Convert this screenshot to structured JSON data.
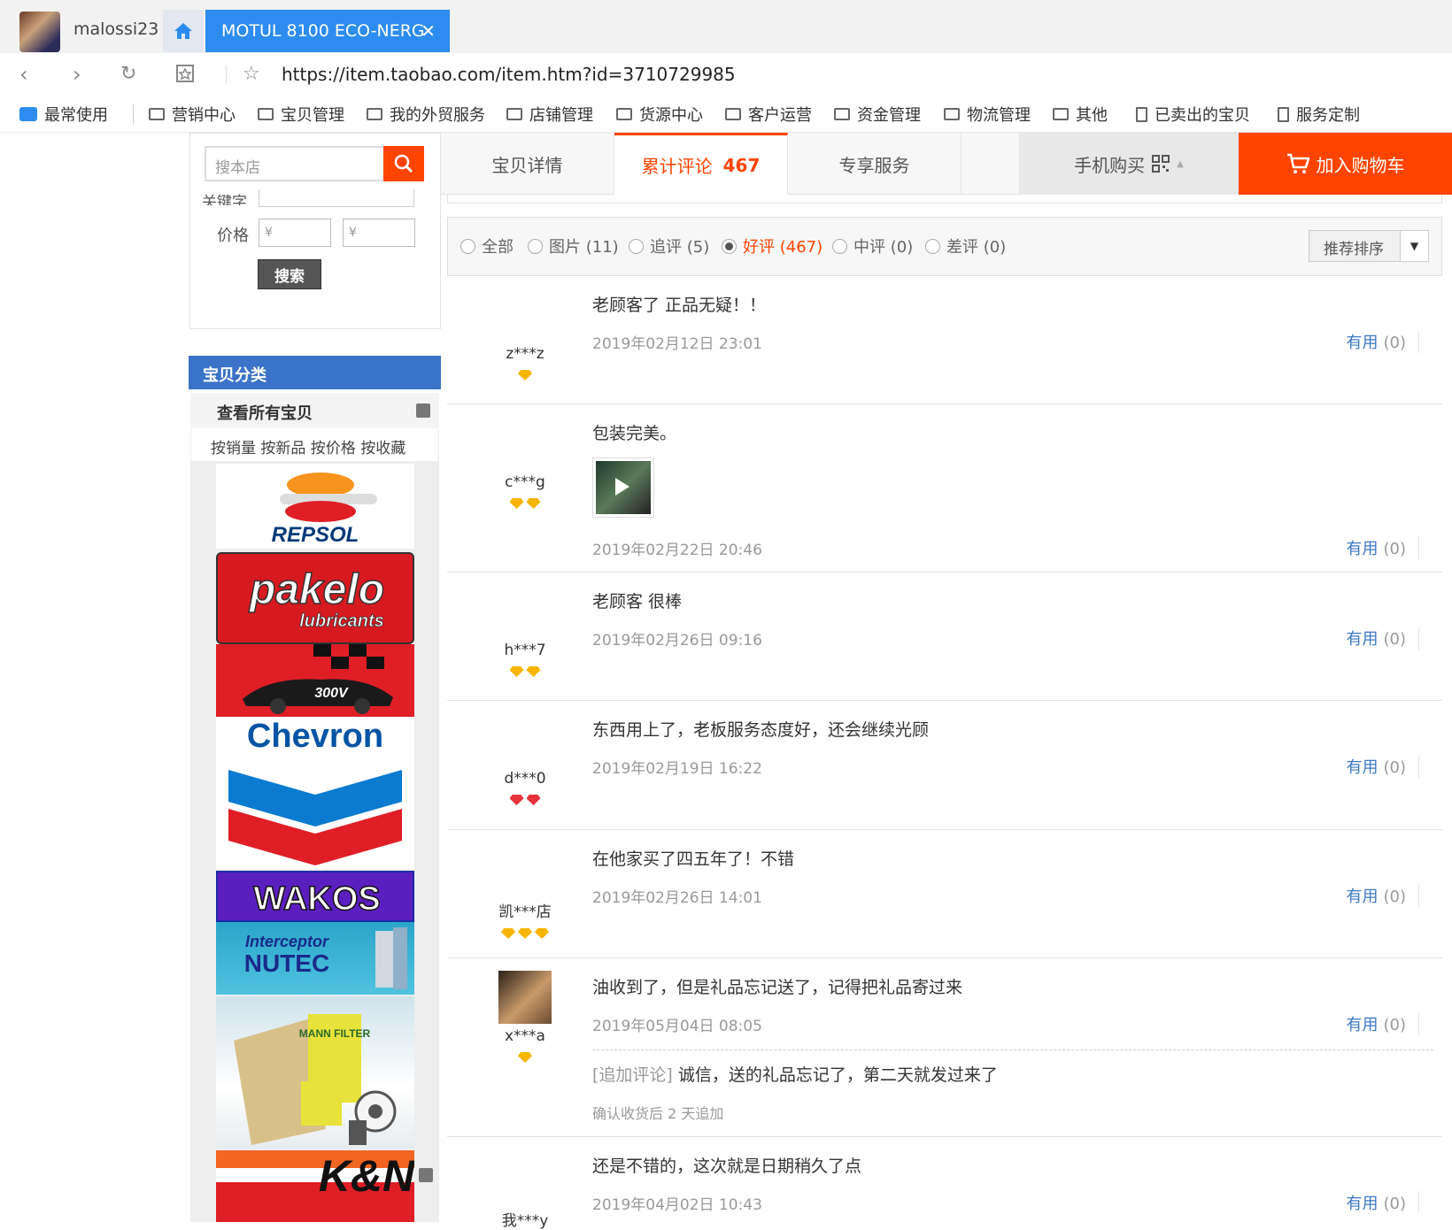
{
  "browser": {
    "profile_name": "malossi23",
    "tab_title": "MOTUL 8100 ECO-NERG",
    "close_glyph": "✕",
    "url": "https://item.taobao.com/item.htm?id=3710729985"
  },
  "bookmarks": [
    "最常使用",
    "营销中心",
    "宝贝管理",
    "我的外贸服务",
    "店铺管理",
    "货源中心",
    "客户运营",
    "资金管理",
    "物流管理",
    "其他",
    "已卖出的宝贝",
    "服务定制"
  ],
  "shop": {
    "search_placeholder": "搜本店",
    "keyword_label": "关键字",
    "price_label": "价格",
    "price_min_placeholder": "¥",
    "price_max_placeholder": "¥",
    "search_button": "搜索",
    "category_title": "宝贝分类",
    "view_all": "查看所有宝贝",
    "sort_options": "按销量 按新品 按价格 按收藏",
    "brand_logos": [
      "REPSOL",
      "pakelo",
      "lubricants",
      "300V",
      "Chevron",
      "WAKOS",
      "Interceptor",
      "NUTEC",
      "MANN FILTER",
      "K&N"
    ]
  },
  "tabs": {
    "details": "宝贝详情",
    "reviews": "累计评论",
    "reviews_count": "467",
    "service": "专享服务",
    "mobile": "手机购买",
    "cart": "加入购物车"
  },
  "filters": [
    {
      "label": "全部"
    },
    {
      "label": "图片 (11)"
    },
    {
      "label": "追评 (5)"
    },
    {
      "label": "好评 (467)",
      "selected": true
    },
    {
      "label": "中评 (0)"
    },
    {
      "label": "差评 (0)"
    }
  ],
  "sort_label": "推荐排序",
  "useful_label": "有用",
  "useful_count": "(0)",
  "reviews": [
    {
      "user": "z***z",
      "text": "老顾客了 正品无疑！！",
      "date": "2019年02月12日 23:01",
      "gems": 1,
      "gem_color": "gold"
    },
    {
      "user": "c***g",
      "text": "包装完美。",
      "date": "2019年02月22日 20:46",
      "gems": 2,
      "gem_color": "gold"
    },
    {
      "user": "h***7",
      "text": "老顾客 很棒",
      "date": "2019年02月26日 09:16",
      "gems": 2,
      "gem_color": "gold"
    },
    {
      "user": "d***0",
      "text": "东西用上了，老板服务态度好，还会继续光顾",
      "date": "2019年02月19日 16:22",
      "gems": 2,
      "gem_color": "red"
    },
    {
      "user": "凯***店",
      "text": "在他家买了四五年了！不错",
      "date": "2019年02月26日 14:01",
      "gems": 3,
      "gem_color": "gold"
    },
    {
      "user": "x***a",
      "text": "油收到了，但是礼品忘记送了，记得把礼品寄过来",
      "date": "2019年05月04日 08:05",
      "gems": 1,
      "gem_color": "gold",
      "append_tag": "[追加评论]",
      "append_text": "诚信，送的礼品忘记了，第二天就发过来了",
      "append_note": "确认收货后 2 天追加"
    },
    {
      "user": "我***y",
      "text": "还是不错的，这次就是日期稍久了点",
      "date": "2019年04月02日 10:43",
      "gems": 0,
      "gem_color": "gold"
    }
  ]
}
